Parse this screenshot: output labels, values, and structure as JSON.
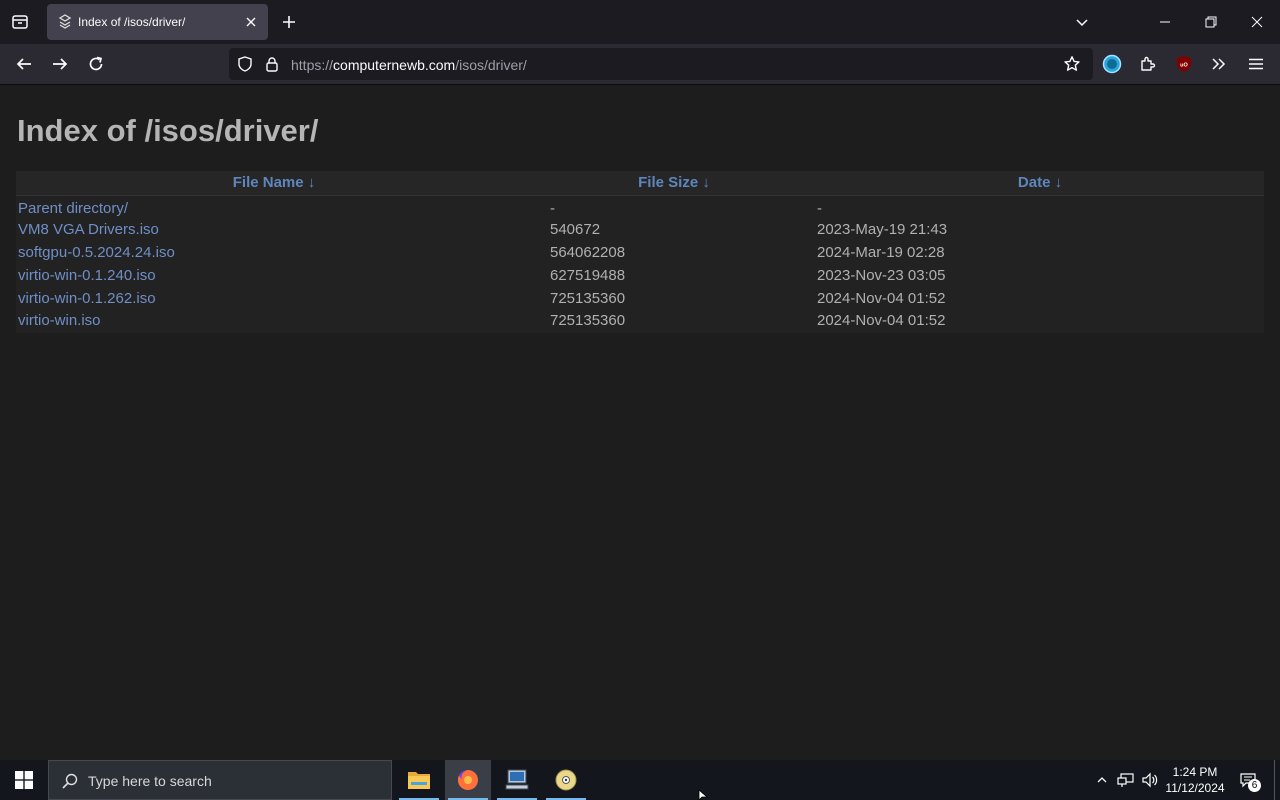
{
  "browser": {
    "tab": {
      "title": "Index of /isos/driver/"
    },
    "url": {
      "prefix": "https://",
      "host": "computernewb.com",
      "path": "/isos/driver/"
    }
  },
  "page": {
    "title": "Index of /isos/driver/",
    "columns": {
      "name": "File Name  ↓",
      "size": "File Size  ↓",
      "date": "Date  ↓"
    },
    "rows": [
      {
        "name": "Parent directory/",
        "size": "-",
        "date": "-"
      },
      {
        "name": "VM8 VGA Drivers.iso",
        "size": "540672",
        "date": "2023-May-19 21:43"
      },
      {
        "name": "softgpu-0.5.2024.24.iso",
        "size": "564062208",
        "date": "2024-Mar-19 02:28"
      },
      {
        "name": "virtio-win-0.1.240.iso",
        "size": "627519488",
        "date": "2023-Nov-23 03:05"
      },
      {
        "name": "virtio-win-0.1.262.iso",
        "size": "725135360",
        "date": "2024-Nov-04 01:52"
      },
      {
        "name": "virtio-win.iso",
        "size": "725135360",
        "date": "2024-Nov-04 01:52"
      }
    ]
  },
  "taskbar": {
    "search_placeholder": "Type here to search",
    "time": "1:24 PM",
    "date": "11/12/2024",
    "notification_count": "6"
  },
  "colors": {
    "link": "#6f8fc6",
    "header_link": "#5e86bd",
    "accent": "#76b9ed"
  }
}
